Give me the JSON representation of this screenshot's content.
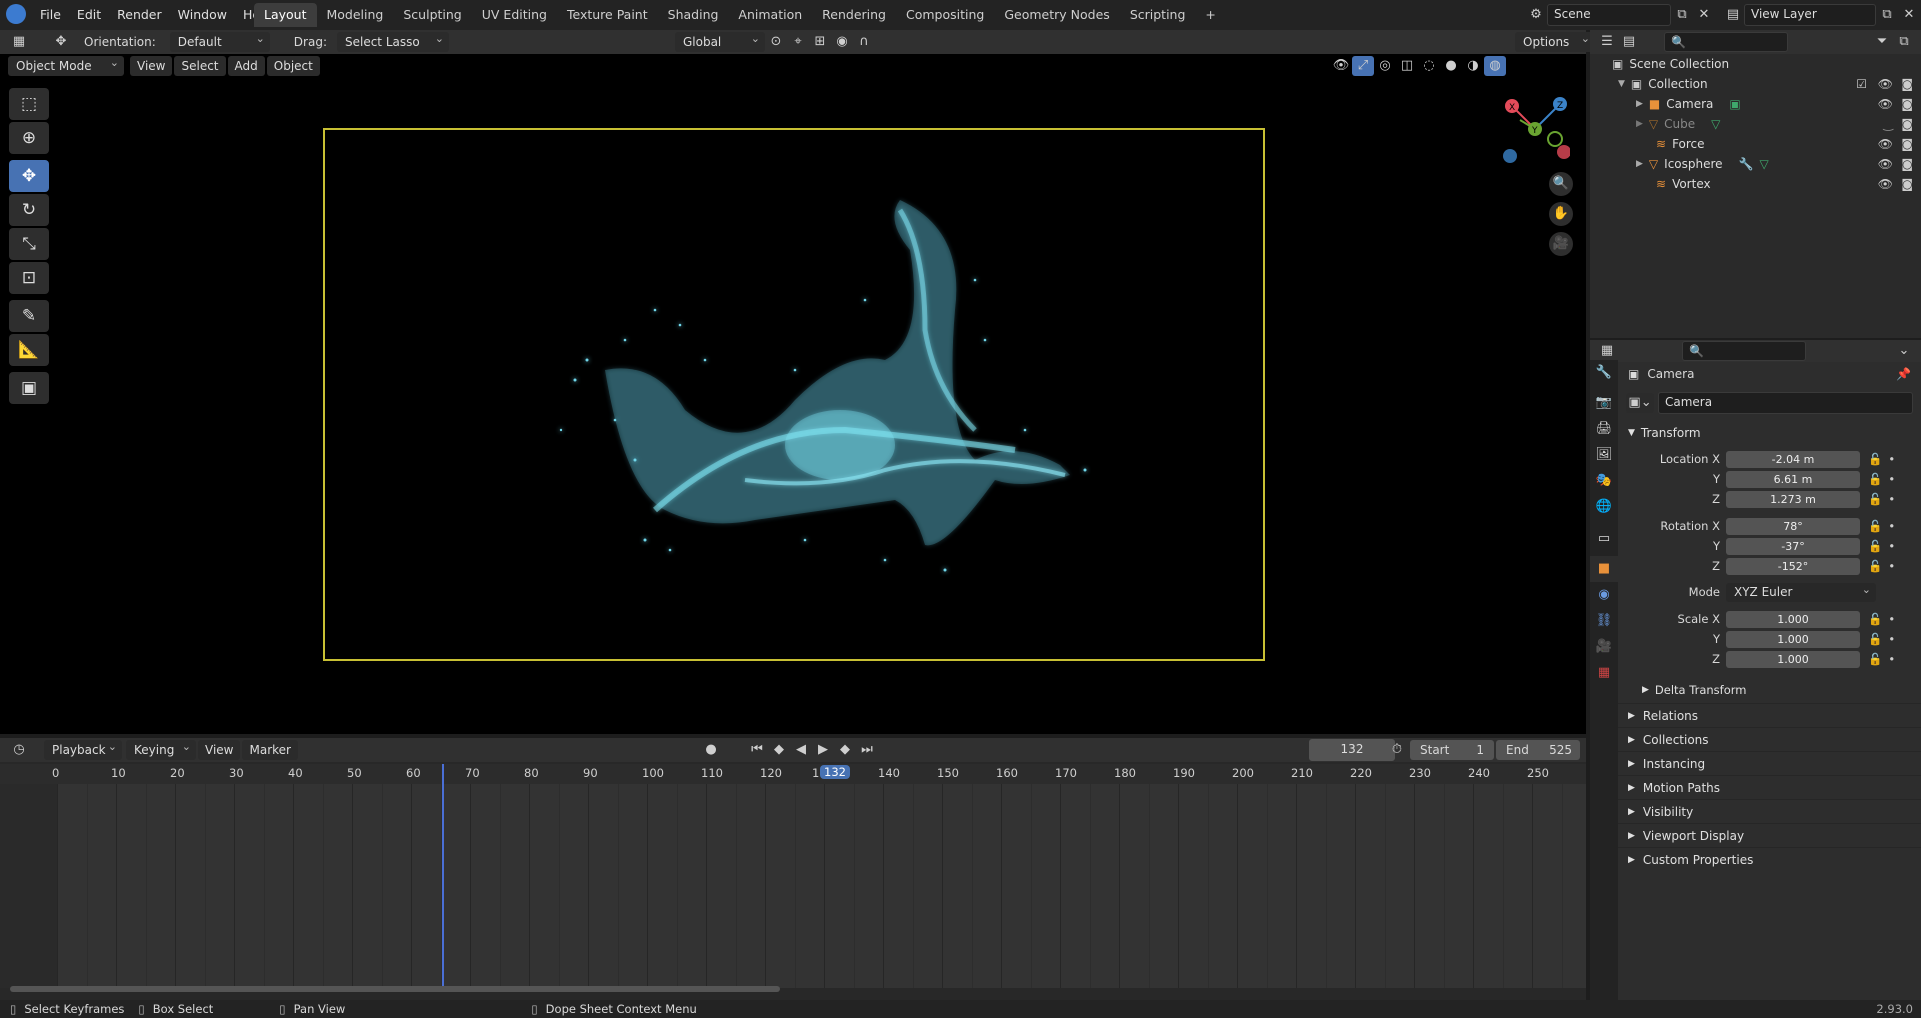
{
  "topbar": {
    "menus": [
      "File",
      "Edit",
      "Render",
      "Window",
      "Help"
    ],
    "workspaces": [
      "Layout",
      "Modeling",
      "Sculpting",
      "UV Editing",
      "Texture Paint",
      "Shading",
      "Animation",
      "Rendering",
      "Compositing",
      "Geometry Nodes",
      "Scripting"
    ],
    "active_workspace": "Layout",
    "add_tab": "+",
    "scene": "Scene",
    "view_layer": "View Layer"
  },
  "tool_header": {
    "orientation_label": "Orientation:",
    "orientation_value": "Default",
    "drag_label": "Drag:",
    "drag_value": "Select Lasso",
    "transform_orientation": "Global",
    "options": "Options"
  },
  "viewport_header": {
    "mode": "Object Mode",
    "menus": [
      "View",
      "Select",
      "Add",
      "Object"
    ]
  },
  "gizmo": {
    "x": "X",
    "y": "Y",
    "z": "Z",
    "x_color": "#e34b5a",
    "y_color": "#6aa431",
    "z_color": "#3b83c9"
  },
  "timeline": {
    "menus": [
      "Playback",
      "Keying",
      "View",
      "Marker"
    ],
    "current_frame": "132",
    "start_label": "Start",
    "start": "1",
    "end_label": "End",
    "end": "525",
    "ticks": [
      "0",
      "10",
      "20",
      "30",
      "40",
      "50",
      "60",
      "70",
      "80",
      "90",
      "100",
      "110",
      "120",
      "1",
      "132",
      "140",
      "150",
      "160",
      "170",
      "180",
      "190",
      "200",
      "210",
      "220",
      "230",
      "240",
      "250"
    ]
  },
  "status": {
    "select": "Select Keyframes",
    "box": "Box Select",
    "pan": "Pan View",
    "context": "Dope Sheet Context Menu",
    "version": "2.93.0"
  },
  "outliner": {
    "root": "Scene Collection",
    "collection": "Collection",
    "items": [
      "Camera",
      "Cube",
      "Force",
      "Icosphere",
      "Vortex"
    ]
  },
  "properties": {
    "object_name": "Camera",
    "data_name": "Camera",
    "transform": "Transform",
    "location_label": "Location X",
    "loc": [
      "-2.04 m",
      "6.61 m",
      "1.273 m"
    ],
    "rotation_label": "Rotation X",
    "rot": [
      "78°",
      "-37°",
      "-152°"
    ],
    "mode_label": "Mode",
    "mode": "XYZ Euler",
    "scale_label": "Scale X",
    "scale": [
      "1.000",
      "1.000",
      "1.000"
    ],
    "y": "Y",
    "z": "Z",
    "delta": "Delta Transform",
    "panels": [
      "Relations",
      "Collections",
      "Instancing",
      "Motion Paths",
      "Visibility",
      "Viewport Display",
      "Custom Properties"
    ]
  },
  "colors": {
    "accent": "#4772b3",
    "particles": "#6fd6ea",
    "camera_frame": "#c8c034",
    "playhead": "#4a6fd6"
  }
}
